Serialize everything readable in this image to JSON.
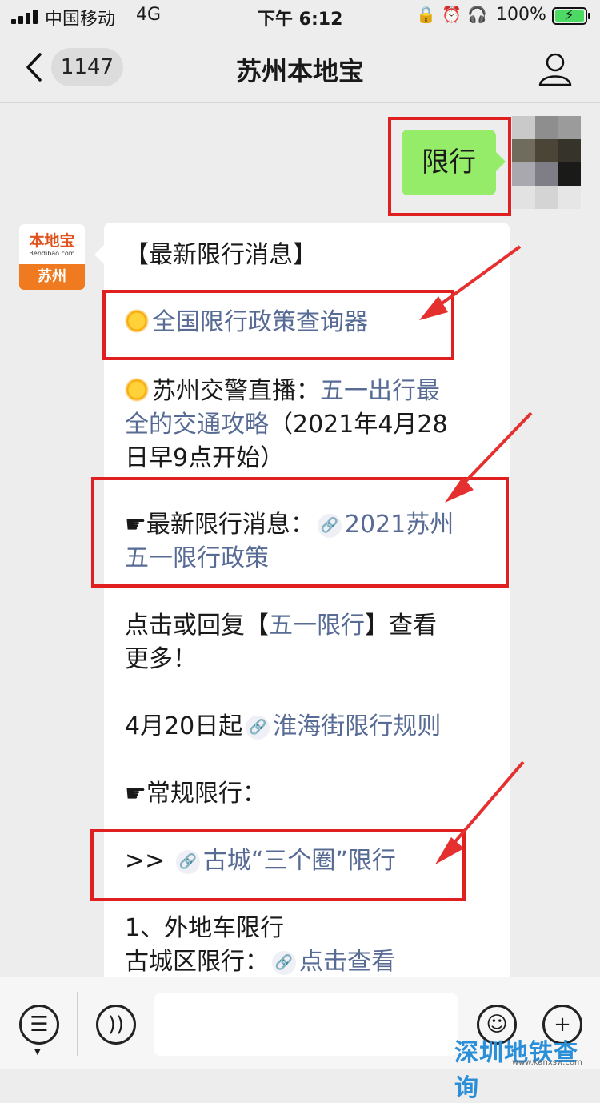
{
  "status_bar": {
    "carrier": "中国移动",
    "network": "4G",
    "time": "下午 6:12",
    "battery": "100%"
  },
  "nav": {
    "back_count": "1147",
    "title": "苏州本地宝"
  },
  "sent_message": "限行",
  "sender_avatar": {
    "logo_text": "本地宝",
    "logo_url": "Bendibao.com",
    "city": "苏州"
  },
  "message": {
    "heading": "【最新限行消息】",
    "query_tool": "全国限行政策查询器",
    "live_prefix": "苏州交警直播：",
    "live_link_1": "五一出行最",
    "live_link_2": "全的交通攻略",
    "live_tail_1": "（2021年4月28",
    "live_tail_2": "日早9点开始）",
    "latest_prefix": "☛最新限行消息：",
    "latest_link_1": "2021苏州",
    "latest_link_2": "五一限行政策",
    "reply_pre": "点击或回复【",
    "reply_link": "五一限行",
    "reply_post": "】查看",
    "reply_line2": "更多！",
    "huaihai_pre": "4月20日起",
    "huaihai_link": "淮海街限行规则",
    "regular": "☛常规限行：",
    "gucheng_pre": ">>",
    "gucheng_link": "古城“三个圈”限行",
    "item1": "1、外地车限行",
    "item1_sub_pre": "古城区限行：",
    "item1_sub_link": "点击查看"
  },
  "watermark": {
    "text": "深圳地铁查询",
    "url": "www.kanxsw.com"
  },
  "colors": {
    "link": "#576b95",
    "bubble": "#95ec69",
    "highlight": "#e02020"
  }
}
